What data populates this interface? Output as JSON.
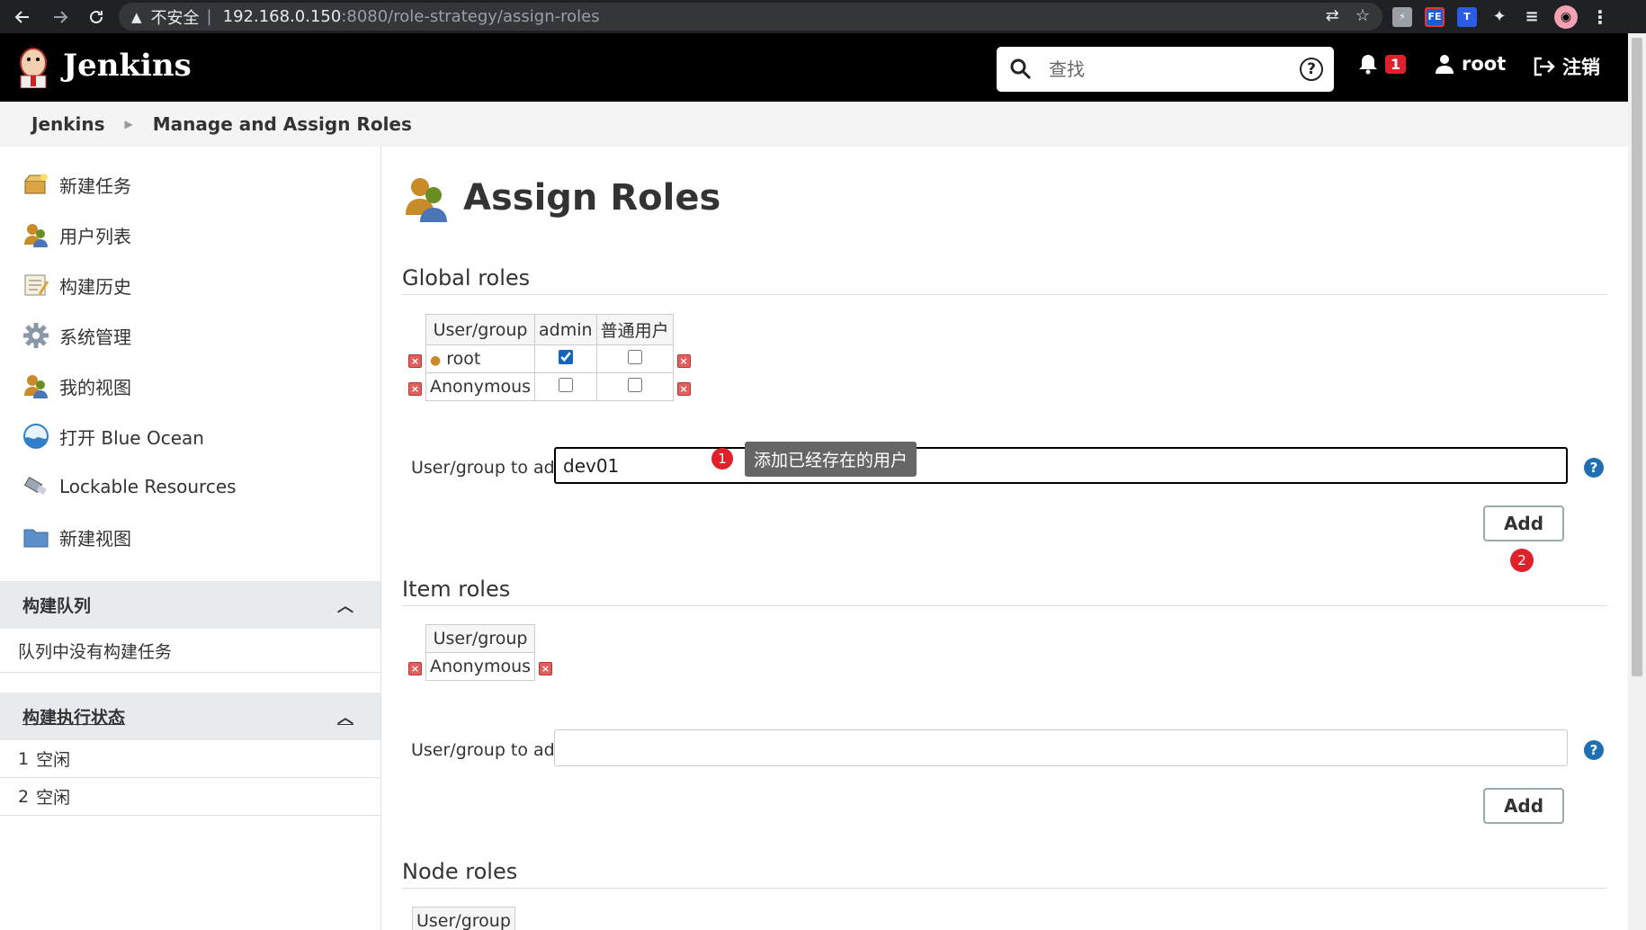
{
  "browser": {
    "security_icon": "warning-triangle-icon",
    "insecure_label": "不安全",
    "url_host": "192.168.0.150",
    "url_rest": ":8080/role-strategy/assign-roles"
  },
  "header": {
    "app_name": "Jenkins",
    "search_placeholder": "查找",
    "help_glyph": "?",
    "notification_count": "1",
    "user_name": "root",
    "logout_label": "注销"
  },
  "breadcrumb": [
    "Jenkins",
    "Manage and Assign Roles"
  ],
  "sidebar": {
    "tasks": [
      {
        "label": "新建任务",
        "icon": "new-item-icon"
      },
      {
        "label": "用户列表",
        "icon": "users-icon"
      },
      {
        "label": "构建历史",
        "icon": "notepad-icon"
      },
      {
        "label": "系统管理",
        "icon": "gear-icon"
      },
      {
        "label": "我的视图",
        "icon": "users-icon"
      },
      {
        "label": "打开 Blue Ocean",
        "icon": "blue-ocean-icon"
      },
      {
        "label": "Lockable Resources",
        "icon": "usb-key-icon"
      },
      {
        "label": "新建视图",
        "icon": "folder-icon"
      }
    ],
    "build_queue": {
      "title": "构建队列",
      "empty_text": "队列中没有构建任务"
    },
    "executors": {
      "title": "构建执行状态",
      "rows": [
        {
          "num": "1",
          "state": "空闲"
        },
        {
          "num": "2",
          "state": "空闲"
        }
      ]
    }
  },
  "main": {
    "title": "Assign Roles",
    "global": {
      "heading": "Global roles",
      "columns": [
        "User/group",
        "admin",
        "普通用户"
      ],
      "rows": [
        {
          "name": "root",
          "admin": true,
          "normal": false
        },
        {
          "name": "Anonymous",
          "admin": false,
          "normal": false
        }
      ],
      "add_label": "User/group to add",
      "add_value": "dev01",
      "add_button": "Add",
      "tooltip": "添加已经存在的用户",
      "step1": "1",
      "step2": "2"
    },
    "item": {
      "heading": "Item roles",
      "columns": [
        "User/group"
      ],
      "rows": [
        {
          "name": "Anonymous"
        }
      ],
      "add_label": "User/group to add",
      "add_value": "",
      "add_button": "Add"
    },
    "node": {
      "heading": "Node roles",
      "columns": [
        "User/group"
      ]
    }
  }
}
